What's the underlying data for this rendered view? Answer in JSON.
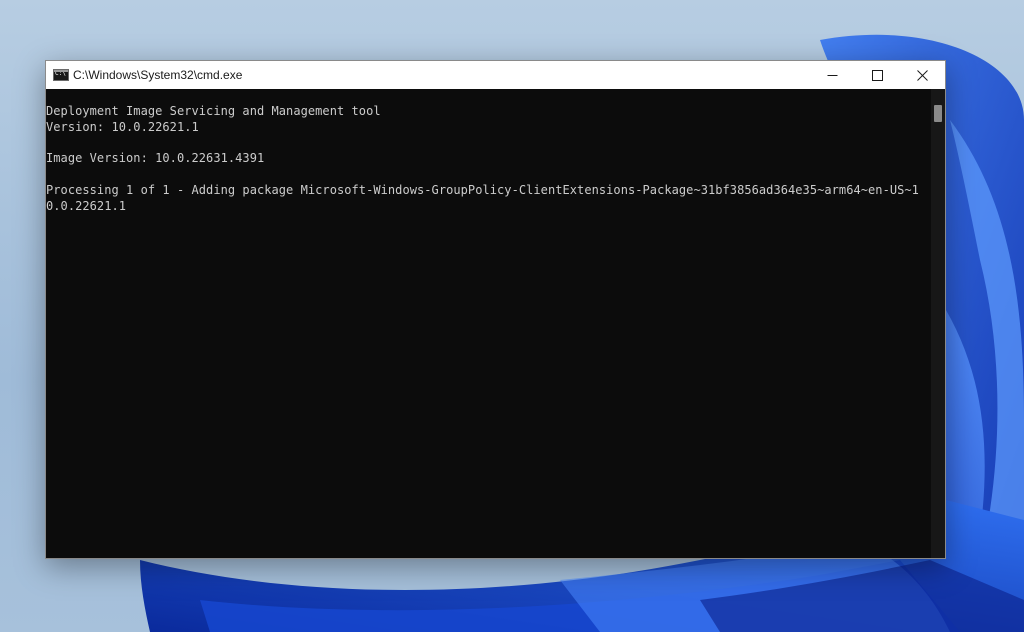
{
  "window": {
    "title": "C:\\Windows\\System32\\cmd.exe",
    "icon": "cmd-icon"
  },
  "caption_buttons": {
    "minimize_icon": "minimize-icon",
    "maximize_icon": "maximize-icon",
    "close_icon": "close-icon"
  },
  "console": {
    "lines": [
      "Deployment Image Servicing and Management tool",
      "Version: 10.0.22621.1",
      "",
      "Image Version: 10.0.22631.4391",
      "",
      "Processing 1 of 1 - Adding package Microsoft-Windows-GroupPolicy-ClientExtensions-Package~31bf3856ad364e35~arm64~en-US~1",
      "0.0.22621.1"
    ],
    "background": "#0c0c0c",
    "foreground": "#cccccc"
  },
  "desktop": {
    "wallpaper": "windows-11-bloom",
    "accent": "#1a5bd8"
  }
}
